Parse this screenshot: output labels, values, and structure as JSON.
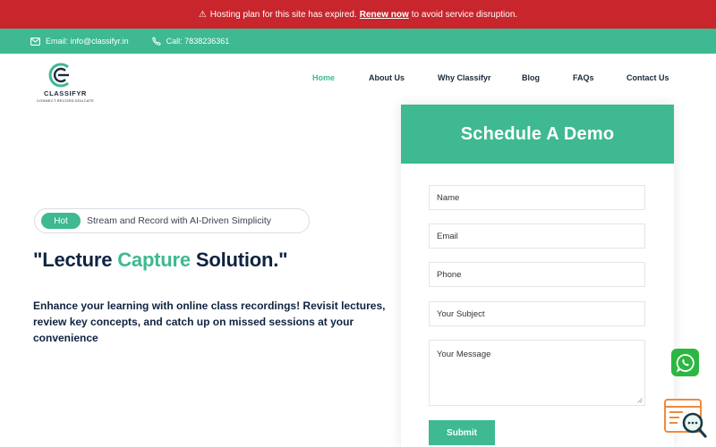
{
  "alert": {
    "icon": "warning-icon",
    "text_before": "Hosting plan for this site has expired.",
    "link": "Renew now",
    "text_after": "to avoid service disruption.",
    "color": "#c8252c"
  },
  "contact": {
    "email": "Email: info@classifyr.in",
    "phone": "Call: 7838236361",
    "color": "#3eb991"
  },
  "logo": {
    "name": "CLASSIFYR",
    "tagline": "CONNECT.RECORD.EDUCATE"
  },
  "nav": {
    "items": [
      {
        "label": "Home",
        "active": true
      },
      {
        "label": "About Us",
        "active": false
      },
      {
        "label": "Why Classifyr",
        "active": false
      },
      {
        "label": "Blog",
        "active": false
      },
      {
        "label": "FAQs",
        "active": false
      },
      {
        "label": "Contact Us",
        "active": false
      }
    ]
  },
  "hero": {
    "badge": "Hot",
    "badge_text": "Stream and Record with AI-Driven Simplicity",
    "headline_pre": "\"Lecture ",
    "headline_accent": "Capture",
    "headline_post": " Solution.\"",
    "description": "Enhance your learning with online class recordings! Revisit lectures, review key concepts, and catch up on missed sessions at your convenience"
  },
  "form": {
    "title": "Schedule A Demo",
    "fields": {
      "name": "Name",
      "email": "Email",
      "phone": "Phone",
      "subject": "Your Subject",
      "message": "Your Message"
    },
    "submit": "Submit"
  },
  "floating": {
    "whatsapp_icon": "whatsapp-icon",
    "chat_icon": "chat-search-icon"
  },
  "colors": {
    "accent": "#3eb991",
    "heading": "#0f2340",
    "alert": "#c8252c"
  }
}
